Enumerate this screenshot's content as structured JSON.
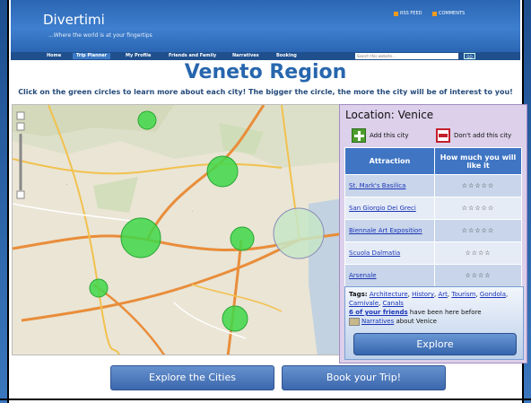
{
  "header": {
    "logo": "Divertimi",
    "tagline": "...Where the world is at your fingertips",
    "rss_label": "RSS FEED",
    "comments_label": "COMMENTS"
  },
  "nav": {
    "items": [
      "Home",
      "Trip Planner",
      "My Profile",
      "Friends and Family",
      "Narratives",
      "Booking"
    ],
    "active": "Trip Planner",
    "search_placeholder": "Search this website...",
    "go_label": "GO"
  },
  "page": {
    "title": "Veneto Region",
    "instructions": "Click on the green circles to learn more about each city!  The bigger the circle, the more the city will be of interest to you!"
  },
  "popup": {
    "location_label": "Location:  Venice",
    "add_label": "Add this city",
    "dont_add_label": "Don't add this city",
    "columns": [
      "Attraction",
      "How much you will like it"
    ],
    "rows": [
      {
        "name": "St. Mark's Basilica",
        "stars": "☆☆☆☆☆",
        "rating": 5
      },
      {
        "name": "San Giorgio Dei Greci",
        "stars": "☆☆☆☆☆",
        "rating": 5
      },
      {
        "name": "Biennale Art Exposition",
        "stars": "☆☆☆☆☆",
        "rating": 5
      },
      {
        "name": "Scuola Dalmatia",
        "stars": "☆☆☆☆",
        "rating": 4
      },
      {
        "name": "Arsenale",
        "stars": "☆☆☆☆",
        "rating": 4
      }
    ],
    "tags_label": "Tags:",
    "tags": [
      "Architecture",
      "History",
      "Art",
      "Tourism",
      "Gondola",
      "Carnivale",
      "Canals"
    ],
    "friends_link": "6 of your friends",
    "friends_text": " have been here before",
    "narratives_link": "Narratives",
    "narratives_text": " about Venice",
    "explore_label": "Explore"
  },
  "buttons": {
    "explore_cities": "Explore the Cities",
    "book_trip": "Book your Trip!"
  },
  "colors": {
    "brand_blue": "#2b66b3",
    "city_circle": "#3fd84a",
    "popup_bg": "#dcd0ea"
  }
}
